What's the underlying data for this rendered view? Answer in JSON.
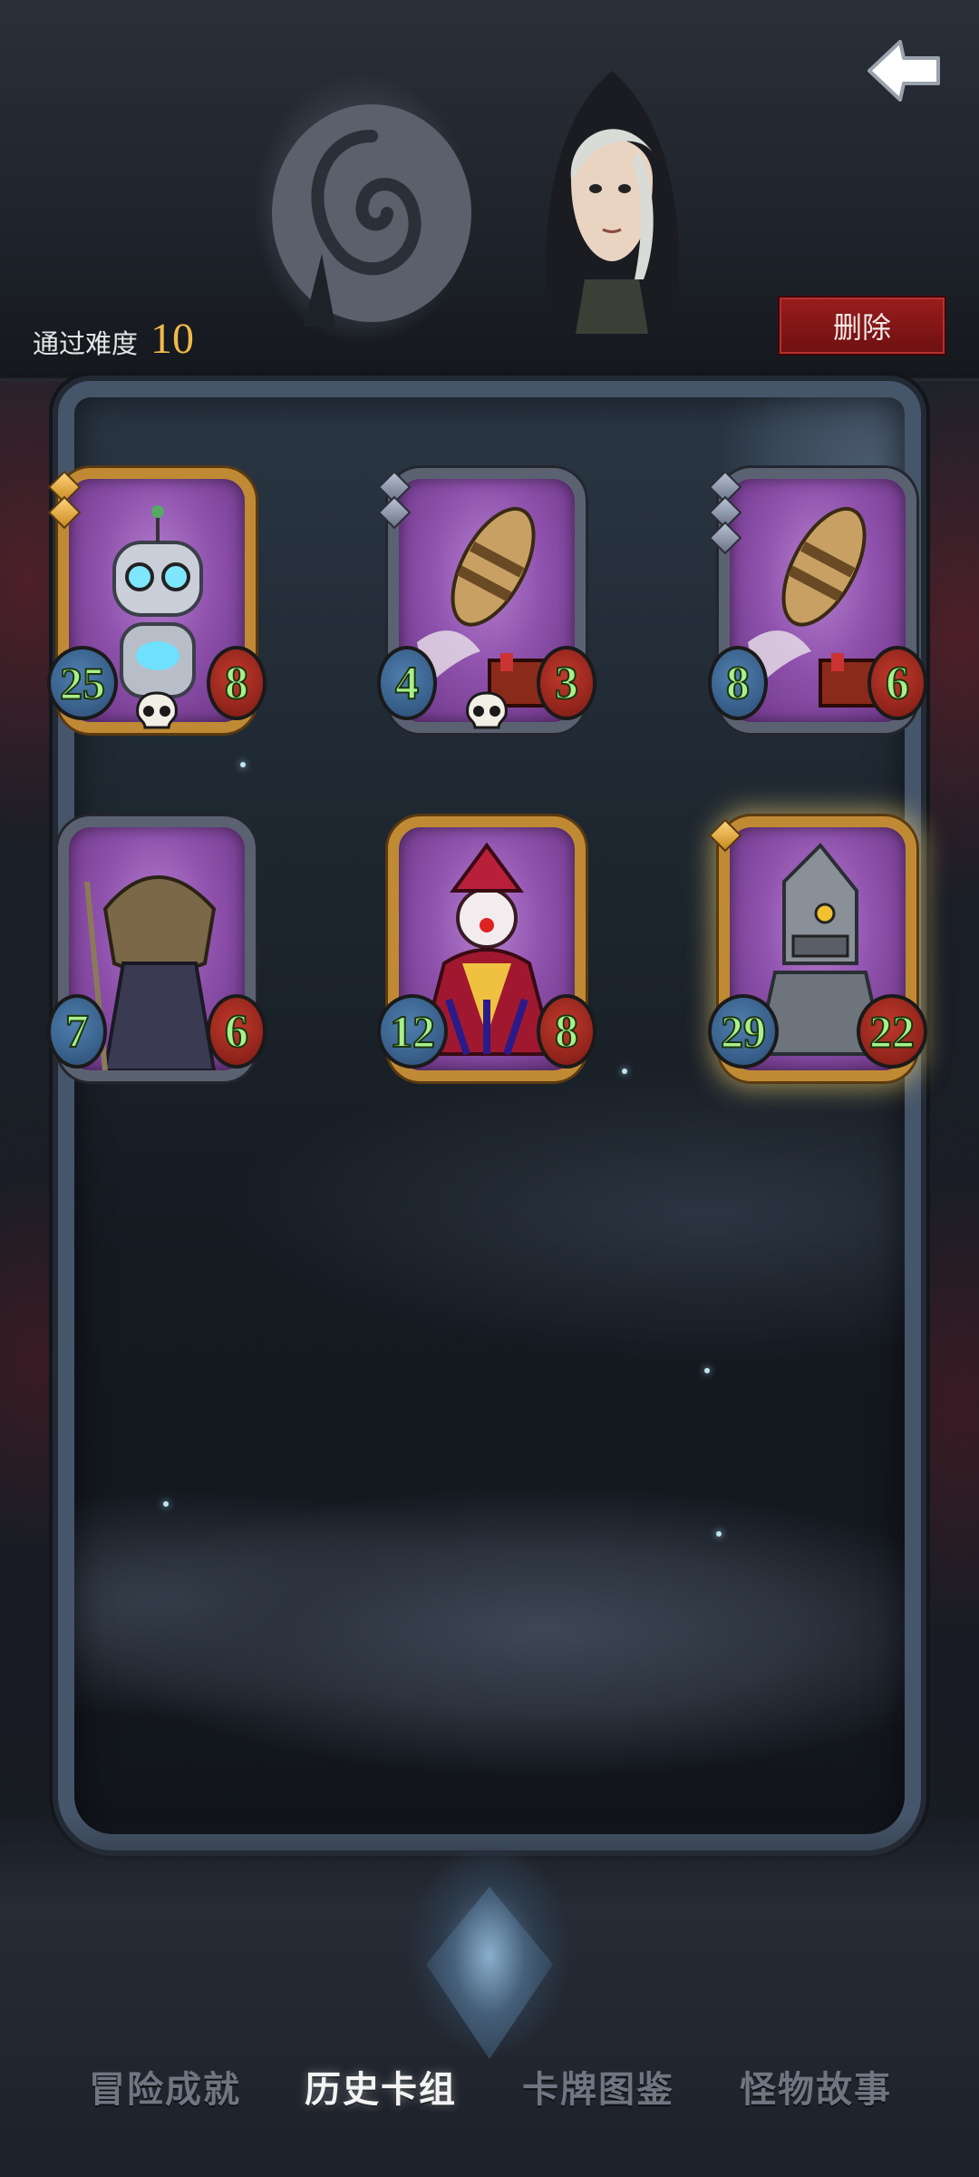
{
  "header": {
    "difficulty_label": "通过难度",
    "difficulty_value": "10",
    "delete_label": "删除"
  },
  "cards": [
    {
      "name": "robot-card",
      "attack": "25",
      "health": "8",
      "frame": "gold",
      "pips": [
        "gold",
        "gold"
      ],
      "skull": true
    },
    {
      "name": "rocket-card-1",
      "attack": "4",
      "health": "3",
      "frame": "silver",
      "pips": [
        "silver",
        "silver"
      ],
      "skull": true
    },
    {
      "name": "rocket-card-2",
      "attack": "8",
      "health": "6",
      "frame": "silver",
      "pips": [
        "silver",
        "silver",
        "silver"
      ],
      "skull": false
    },
    {
      "name": "scarecrow-card",
      "attack": "7",
      "health": "6",
      "frame": "silver",
      "pips": [],
      "skull": false
    },
    {
      "name": "clown-card",
      "attack": "12",
      "health": "8",
      "frame": "gold",
      "pips": [],
      "skull": false
    },
    {
      "name": "tin-knight-card",
      "attack": "29",
      "health": "22",
      "frame": "gold",
      "pips": [
        "gold"
      ],
      "skull": false,
      "glow": true
    }
  ],
  "tabs": [
    {
      "label": "冒险成就",
      "active": false
    },
    {
      "label": "历史卡组",
      "active": true
    },
    {
      "label": "卡牌图鉴",
      "active": false
    },
    {
      "label": "怪物故事",
      "active": false
    }
  ],
  "colors": {
    "attack_text": "#a8f08a",
    "difficulty_value": "#f0b94a",
    "delete_button": "#8a1818",
    "active_tab": "#f4f4f4",
    "inactive_tab": "#6f7682"
  },
  "icons": [
    "back-arrow-icon",
    "skull-icon",
    "rarity-pip-icon"
  ]
}
